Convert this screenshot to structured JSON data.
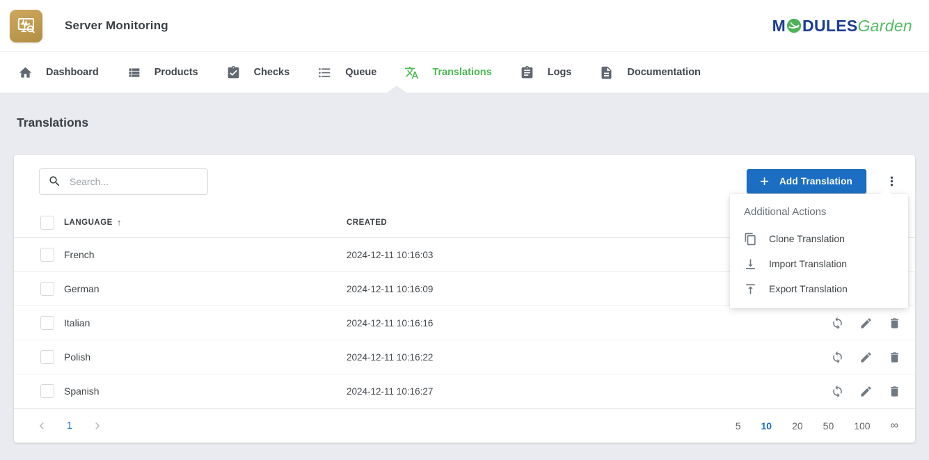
{
  "header": {
    "app_title": "Server Monitoring",
    "logo": {
      "prefix": "M",
      "middle": "DULES",
      "tail": "Garden"
    }
  },
  "nav": {
    "items": [
      {
        "label": "Dashboard",
        "icon": "home-icon",
        "active": false
      },
      {
        "label": "Products",
        "icon": "view-list-icon",
        "active": false
      },
      {
        "label": "Checks",
        "icon": "clipboard-check-icon",
        "active": false
      },
      {
        "label": "Queue",
        "icon": "bulleted-list-icon",
        "active": false
      },
      {
        "label": "Translations",
        "icon": "translate-icon",
        "active": true
      },
      {
        "label": "Logs",
        "icon": "clipboard-list-icon",
        "active": false
      },
      {
        "label": "Documentation",
        "icon": "document-icon",
        "active": false
      }
    ]
  },
  "page": {
    "title": "Translations"
  },
  "toolbar": {
    "search_placeholder": "Search...",
    "add_button_label": "Add Translation",
    "kebab_icon": "more-vertical-icon"
  },
  "menu": {
    "title": "Additional Actions",
    "items": [
      {
        "label": "Clone Translation",
        "icon": "clone-icon"
      },
      {
        "label": "Import Translation",
        "icon": "import-icon"
      },
      {
        "label": "Export Translation",
        "icon": "export-icon"
      }
    ]
  },
  "table": {
    "columns": {
      "language": "LANGUAGE",
      "created": "CREATED"
    },
    "sort": {
      "column": "LANGUAGE",
      "direction": "asc",
      "indicator": "↑"
    },
    "row_action_icons": [
      "sync-icon",
      "edit-icon",
      "delete-icon"
    ],
    "rows": [
      {
        "language": "French",
        "created": "2024-12-11 10:16:03"
      },
      {
        "language": "German",
        "created": "2024-12-11 10:16:09"
      },
      {
        "language": "Italian",
        "created": "2024-12-11 10:16:16"
      },
      {
        "language": "Polish",
        "created": "2024-12-11 10:16:22"
      },
      {
        "language": "Spanish",
        "created": "2024-12-11 10:16:27"
      }
    ]
  },
  "pagination": {
    "current_page": "1",
    "page_sizes": [
      "5",
      "10",
      "20",
      "50",
      "100",
      "∞"
    ],
    "active_page_size": "10"
  },
  "colors": {
    "accent_green": "#4cba54",
    "primary_blue": "#1b6ec2",
    "link_blue": "#1a6fc4",
    "background": "#e9ebf0",
    "icon_gold": "#bb9848"
  }
}
